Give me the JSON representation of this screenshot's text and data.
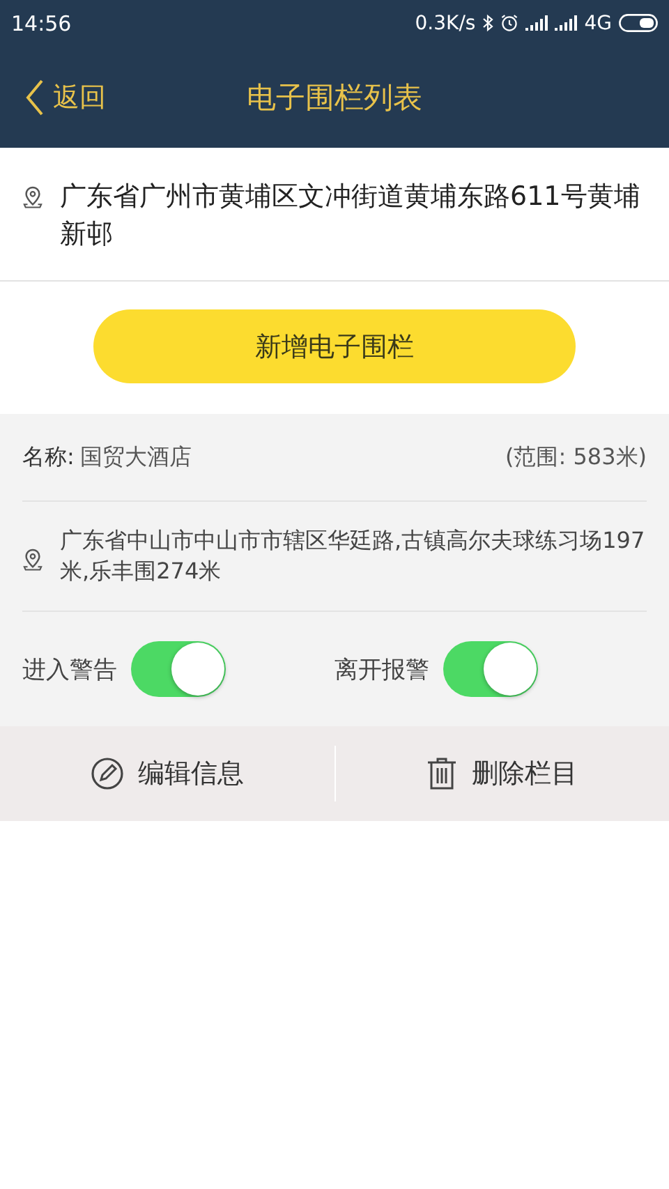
{
  "status_bar": {
    "time": "14:56",
    "speed": "0.3K/s",
    "network": "4G"
  },
  "header": {
    "back": "返回",
    "title": "电子围栏列表"
  },
  "current_address": "广东省广州市黄埔区文冲街道黄埔东路611号黄埔新邨",
  "add_button": "新增电子围栏",
  "fences": [
    {
      "name_label": "名称:",
      "name": "国贸大酒店",
      "range": "(范围: 583米)",
      "address": "广东省中山市中山市市辖区华廷路,古镇高尔夫球练习场197米,乐丰围274米",
      "toggles": [
        {
          "label": "进入警告",
          "on": true
        },
        {
          "label": "离开报警",
          "on": true
        }
      ],
      "actions": [
        {
          "kind": "edit",
          "label": "编辑信息"
        },
        {
          "kind": "delete",
          "label": "删除栏目"
        }
      ]
    }
  ]
}
